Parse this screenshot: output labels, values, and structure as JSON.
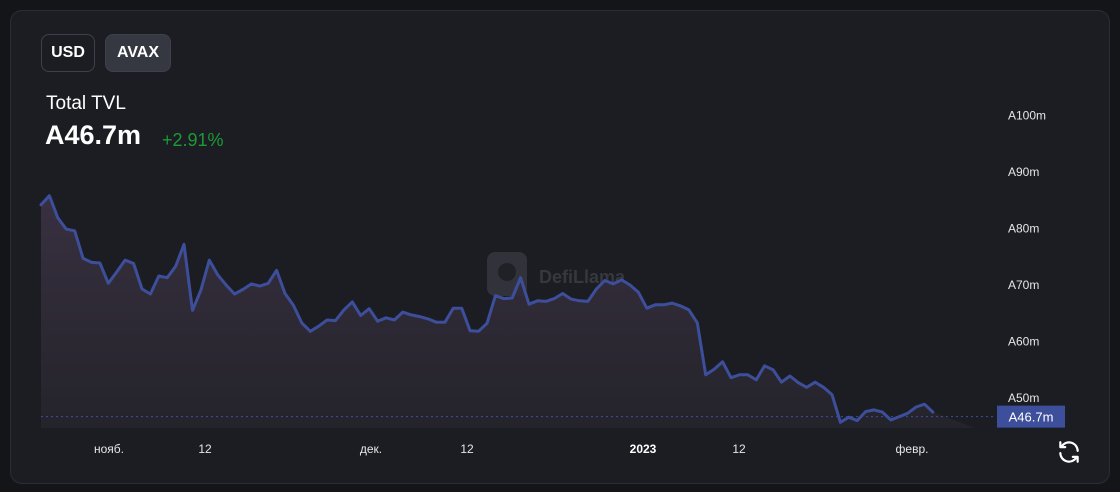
{
  "controls": {
    "usd_label": "USD",
    "avax_label": "AVAX"
  },
  "header": {
    "title": "Total TVL",
    "value": "A46.7m",
    "change": "+2.91%"
  },
  "watermark": "DefiLlama",
  "colors": {
    "line": "#3d4e9b",
    "change_positive": "#1b9b36",
    "current_badge": "#3d4e9b"
  },
  "icons": {
    "reload": "reload-icon"
  },
  "chart_data": {
    "type": "area",
    "y_axis": {
      "ticks": [
        50,
        60,
        70,
        80,
        90,
        100
      ],
      "tick_labels": [
        "A50m",
        "A60m",
        "A70m",
        "A80m",
        "A90m",
        "A100m"
      ],
      "unit": "A, millions"
    },
    "x_axis": {
      "tick_labels": [
        "нояб.",
        "12",
        "дек.",
        "12",
        "2023",
        "12",
        "февр."
      ]
    },
    "current_value": 46.7,
    "current_label": "A46.7m",
    "x": [
      "2022-10-20",
      "2022-10-21",
      "2022-10-22",
      "2022-10-23",
      "2022-10-24",
      "2022-10-25",
      "2022-10-26",
      "2022-10-27",
      "2022-10-28",
      "2022-10-29",
      "2022-10-30",
      "2022-10-31",
      "2022-11-01",
      "2022-11-02",
      "2022-11-03",
      "2022-11-04",
      "2022-11-05",
      "2022-11-06",
      "2022-11-07",
      "2022-11-08",
      "2022-11-09",
      "2022-11-10",
      "2022-11-11",
      "2022-11-12",
      "2022-11-13",
      "2022-11-14",
      "2022-11-15",
      "2022-11-16",
      "2022-11-17",
      "2022-11-18",
      "2022-11-19",
      "2022-11-20",
      "2022-11-21",
      "2022-11-22",
      "2022-11-23",
      "2022-11-24",
      "2022-11-25",
      "2022-11-26",
      "2022-11-27",
      "2022-11-28",
      "2022-11-29",
      "2022-11-30",
      "2022-12-01",
      "2022-12-02",
      "2022-12-03",
      "2022-12-04",
      "2022-12-05",
      "2022-12-06",
      "2022-12-07",
      "2022-12-08",
      "2022-12-09",
      "2022-12-10",
      "2022-12-11",
      "2022-12-12",
      "2022-12-13",
      "2022-12-14",
      "2022-12-15",
      "2022-12-16",
      "2022-12-17",
      "2022-12-18",
      "2022-12-19",
      "2022-12-20",
      "2022-12-21",
      "2022-12-22",
      "2022-12-23",
      "2022-12-24",
      "2022-12-25",
      "2022-12-26",
      "2022-12-27",
      "2022-12-28",
      "2022-12-29",
      "2022-12-30",
      "2022-12-31",
      "2023-01-01",
      "2023-01-02",
      "2023-01-03",
      "2023-01-04",
      "2023-01-05",
      "2023-01-06",
      "2023-01-07",
      "2023-01-08",
      "2023-01-09",
      "2023-01-10",
      "2023-01-11",
      "2023-01-12",
      "2023-01-13",
      "2023-01-14",
      "2023-01-15",
      "2023-01-16",
      "2023-01-17",
      "2023-01-18",
      "2023-01-19",
      "2023-01-20",
      "2023-01-21",
      "2023-01-22",
      "2023-01-23",
      "2023-01-24",
      "2023-01-25",
      "2023-01-26",
      "2023-01-27",
      "2023-01-28",
      "2023-01-29",
      "2023-01-30",
      "2023-01-31",
      "2023-02-01",
      "2023-02-02",
      "2023-02-03",
      "2023-02-04",
      "2023-02-05",
      "2023-02-06",
      "2023-02-07",
      "2023-02-08"
    ],
    "series": [
      {
        "values": [
          84.2,
          85.8,
          81.9,
          79.9,
          79.6,
          74.7,
          74.0,
          73.9,
          70.3,
          72.3,
          74.4,
          73.8,
          69.3,
          68.4,
          71.6,
          71.3,
          73.3,
          77.2,
          65.5,
          69.1,
          74.4,
          71.8,
          70.0,
          68.4,
          69.2,
          70.2,
          69.8,
          70.3,
          72.6,
          68.5,
          66.4,
          63.3,
          61.8,
          62.7,
          63.8,
          63.7,
          65.6,
          67.0,
          64.6,
          65.8,
          63.6,
          64.2,
          63.8,
          65.2,
          64.7,
          64.4,
          64.0,
          63.4,
          63.4,
          65.9,
          65.9,
          61.9,
          61.8,
          63.2,
          68.1,
          67.6,
          67.7,
          71.3,
          66.6,
          67.2,
          67.1,
          67.6,
          68.5,
          67.5,
          67.2,
          67.1,
          69.3,
          70.8,
          70.2,
          70.9,
          70.0,
          68.7,
          65.9,
          66.5,
          66.5,
          66.8,
          66.3,
          65.6,
          63.3,
          54.1,
          55.1,
          56.4,
          53.6,
          54.1,
          54.1,
          53.2,
          55.7,
          55.0,
          52.8,
          53.9,
          52.7,
          51.9,
          52.8,
          51.9,
          50.6,
          45.7,
          46.6,
          46.0,
          47.6,
          47.9,
          47.5,
          46.1,
          46.7,
          47.3,
          48.4,
          48.9,
          47.5
        ]
      }
    ]
  }
}
